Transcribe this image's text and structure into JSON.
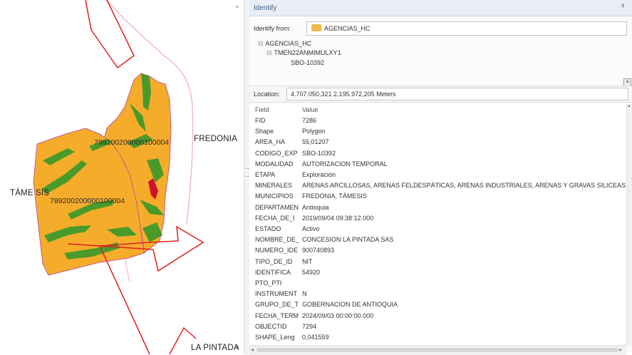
{
  "map": {
    "parcel_code_upper": "789200200000100004",
    "parcel_code_lower": "789200200000100004",
    "place_fredonia": "FREDONIA",
    "place_tamesis": "TÁME SIS",
    "place_la_pintada": "LA PINTADA",
    "colors": {
      "parcel_fill": "#f6ac2b",
      "vegetation": "#4a9a2a",
      "boundary": "#e02020",
      "highlight": "#d0112b",
      "river": "#f3b9c5"
    },
    "scroll_up": "^",
    "scroll_down": "v"
  },
  "panel": {
    "title": "Identify",
    "pin": "ᵠ",
    "identify_from_label": "Identify from:",
    "identify_from_value": "AGENCIAS_HC",
    "tree": {
      "layer": "AGENCIAS_HC",
      "feature": "TMEN22ANMIMULXY1",
      "value": "SBO-10392"
    },
    "location_label": "Location:",
    "location_value": "4.707.050,321  2.195.972,205 Meters",
    "field_header": "Field",
    "value_header": "Value",
    "attributes": [
      {
        "field": "FID",
        "value": "7286"
      },
      {
        "field": "Shape",
        "value": "Polygon"
      },
      {
        "field": "AREA_HA",
        "value": "55,01207"
      },
      {
        "field": "CODIGO_EXP",
        "value": "SBO-10392"
      },
      {
        "field": "MODALIDAD",
        "value": "AUTORIZACION TEMPORAL"
      },
      {
        "field": "ETAPA",
        "value": "Exploración"
      },
      {
        "field": "MINERALES",
        "value": "ARENAS ARCILLOSAS, ARENAS FELDESPÁTICAS, ARENAS INDUSTRIALES, ARENAS Y GRAVAS SILICEAS, GRA"
      },
      {
        "field": "MUNICIPIOS",
        "value": "FREDONIA, TÁMESIS"
      },
      {
        "field": "DEPARTAMEN",
        "value": "Antioquia"
      },
      {
        "field": "FECHA_DE_I",
        "value": "2019/09/04 09:38:12.000"
      },
      {
        "field": "ESTADO",
        "value": "Activo"
      },
      {
        "field": "NOMBRE_DE_",
        "value": "CONCESION LA PINTADA SAS"
      },
      {
        "field": "NUMERO_IDE",
        "value": "900740893"
      },
      {
        "field": "TIPO_DE_ID",
        "value": "NIT"
      },
      {
        "field": "IDENTIFICA",
        "value": "54920"
      },
      {
        "field": "PTO_PTI",
        "value": ""
      },
      {
        "field": "INSTRUMENT",
        "value": "N"
      },
      {
        "field": "GRUPO_DE_T",
        "value": "GOBERNACION DE ANTIOQUIA"
      },
      {
        "field": "FECHA_TERM",
        "value": "2024/09/03 00:00:00.000"
      },
      {
        "field": "OBJECTID",
        "value": "7294"
      },
      {
        "field": "SHAPE_Leng",
        "value": "0,041559"
      }
    ]
  }
}
